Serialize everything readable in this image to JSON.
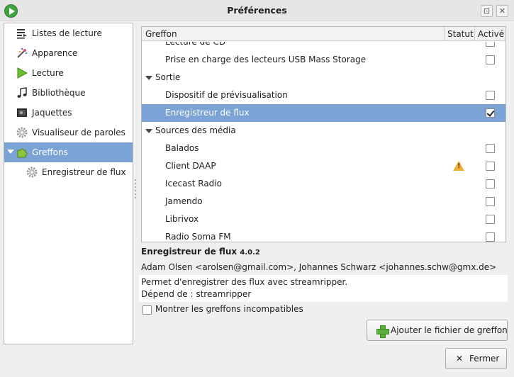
{
  "window": {
    "title": "Préférences",
    "controls": {
      "maximize": "⊡",
      "close": "✕"
    }
  },
  "sidebar": {
    "items": [
      {
        "label": "Listes de lecture",
        "icon": "playlist-icon"
      },
      {
        "label": "Apparence",
        "icon": "appearance-wand-icon"
      },
      {
        "label": "Lecture",
        "icon": "play-icon"
      },
      {
        "label": "Bibliothèque",
        "icon": "music-note-icon"
      },
      {
        "label": "Jaquettes",
        "icon": "cover-art-icon"
      },
      {
        "label": "Visualiseur de paroles",
        "icon": "gear-icon"
      },
      {
        "label": "Greffons",
        "icon": "puzzle-icon",
        "selected": true,
        "expanded": true
      },
      {
        "label": "Enregistreur de flux",
        "icon": "gear-icon",
        "sub": true
      }
    ]
  },
  "plugins": {
    "columns": {
      "name": "Greffon",
      "status": "Statut",
      "enabled": "Activé"
    },
    "rows": [
      {
        "type": "plugin",
        "label": "Lecture de CD",
        "checked": false
      },
      {
        "type": "plugin",
        "label": "Prise en charge des lecteurs USB Mass Storage",
        "checked": false
      },
      {
        "type": "group",
        "label": "Sortie"
      },
      {
        "type": "plugin",
        "label": "Dispositif de prévisualisation",
        "checked": false
      },
      {
        "type": "plugin",
        "label": "Enregistreur de flux",
        "checked": true,
        "selected": true
      },
      {
        "type": "group",
        "label": "Sources des média"
      },
      {
        "type": "plugin",
        "label": "Balados",
        "checked": false
      },
      {
        "type": "plugin",
        "label": "Client DAAP",
        "checked": false,
        "warning": true
      },
      {
        "type": "plugin",
        "label": "Icecast Radio",
        "checked": false
      },
      {
        "type": "plugin",
        "label": "Jamendo",
        "checked": false
      },
      {
        "type": "plugin",
        "label": "Librivox",
        "checked": false
      },
      {
        "type": "plugin",
        "label": "Radio Soma FM",
        "checked": false
      }
    ]
  },
  "details": {
    "name": "Enregistreur de flux",
    "version": "4.0.2",
    "authors": "Adam Olsen <arolsen@gmail.com>, Johannes Schwarz <johannes.schw@gmx.de>",
    "description": "Permet d'enregistrer des flux avec streamripper.",
    "depends": "Dépend de : streamripper"
  },
  "show_incompatible": {
    "label": "Montrer les greffons incompatibles",
    "checked": false
  },
  "buttons": {
    "add_plugin": "Ajouter le fichier de greffon",
    "close": "Fermer"
  },
  "colors": {
    "selection": "#7ba3d6",
    "warning": "#f0b030",
    "plus_green": "#5bb03b"
  }
}
